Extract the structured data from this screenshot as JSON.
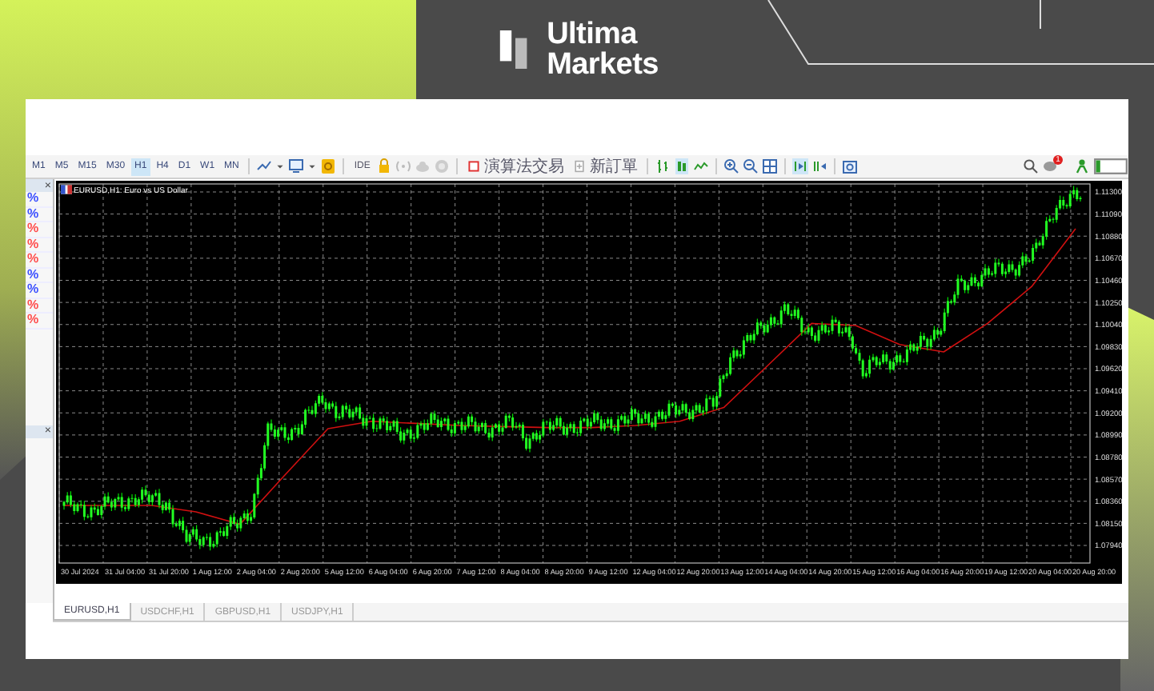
{
  "brand": {
    "line_1": "Ultima",
    "line_2": "Markets"
  },
  "toolbar": {
    "timeframes": [
      {
        "label": "M1",
        "selected": false
      },
      {
        "label": "M5",
        "selected": false
      },
      {
        "label": "M15",
        "selected": false
      },
      {
        "label": "M30",
        "selected": false
      },
      {
        "label": "H1",
        "selected": true
      },
      {
        "label": "H4",
        "selected": false
      },
      {
        "label": "D1",
        "selected": false
      },
      {
        "label": "W1",
        "selected": false
      },
      {
        "label": "MN",
        "selected": false
      }
    ],
    "ide_label": "IDE",
    "algo_trading_label": "演算法交易",
    "new_order_label": "新訂單",
    "notification_count": "1"
  },
  "market_watch": {
    "close_symbol": "×",
    "rows": [
      {
        "change": "%",
        "color": "#3c50ff"
      },
      {
        "change": "%",
        "color": "#3c50ff"
      },
      {
        "change": "%",
        "color": "#ff4d4d"
      },
      {
        "change": "%",
        "color": "#ff4d4d"
      },
      {
        "change": "%",
        "color": "#ff4d4d"
      },
      {
        "change": "%",
        "color": "#3c50ff"
      },
      {
        "change": "%",
        "color": "#3c50ff"
      },
      {
        "change": "%",
        "color": "#ff4d4d"
      },
      {
        "change": "%",
        "color": "#ff4d4d"
      }
    ]
  },
  "navigator": {
    "close_symbol": "×"
  },
  "chart": {
    "title": "EURUSD,H1: Euro vs US Dollar",
    "chart_data": {
      "type": "line",
      "grid": true,
      "categories": [
        "30 Jul 2024",
        "31 Jul 04:00",
        "31 Jul 20:00",
        "1 Aug 12:00",
        "2 Aug 04:00",
        "2 Aug 20:00",
        "5 Aug 12:00",
        "6 Aug 04:00",
        "6 Aug 20:00",
        "7 Aug 12:00",
        "8 Aug 04:00",
        "8 Aug 20:00",
        "9 Aug 12:00",
        "12 Aug 04:00",
        "12 Aug 20:00",
        "13 Aug 12:00",
        "14 Aug 04:00",
        "14 Aug 20:00",
        "15 Aug 12:00",
        "16 Aug 04:00",
        "16 Aug 20:00",
        "19 Aug 12:00",
        "20 Aug 04:00",
        "20 Aug 20:00"
      ],
      "ylim": [
        1.0794,
        1.113
      ],
      "yticks": [
        {
          "value": 1.113,
          "label": "1.11300"
        },
        {
          "value": 1.1109,
          "label": "1.11090"
        },
        {
          "value": 1.1088,
          "label": "1.10880"
        },
        {
          "value": 1.1067,
          "label": "1.10670"
        },
        {
          "value": 1.1046,
          "label": "1.10460"
        },
        {
          "value": 1.1025,
          "label": "1.10250"
        },
        {
          "value": 1.1004,
          "label": "1.10040"
        },
        {
          "value": 1.0983,
          "label": "1.09830"
        },
        {
          "value": 1.0962,
          "label": "1.09620"
        },
        {
          "value": 1.0941,
          "label": "1.09410"
        },
        {
          "value": 1.092,
          "label": "1.09200"
        },
        {
          "value": 1.0899,
          "label": "1.08990"
        },
        {
          "value": 1.0878,
          "label": "1.08780"
        },
        {
          "value": 1.0857,
          "label": "1.08570"
        },
        {
          "value": 1.0836,
          "label": "1.08360"
        },
        {
          "value": 1.0815,
          "label": "1.08150"
        },
        {
          "value": 1.0794,
          "label": "1.07940"
        }
      ],
      "series": [
        {
          "color": "#d01010",
          "values": [
            1.0832,
            1.0832,
            1.0832,
            1.0826,
            1.0814,
            1.086,
            1.0905,
            1.0912,
            1.091,
            1.0908,
            1.0907,
            1.0906,
            1.0906,
            1.0908,
            1.0912,
            1.0925,
            1.0965,
            1.1005,
            1.1003,
            1.0985,
            1.0978,
            1.1005,
            1.104,
            1.1095
          ]
        }
      ]
    }
  },
  "chart_tabs": [
    {
      "label": "EURUSD,H1",
      "selected": true
    },
    {
      "label": "USDCHF,H1",
      "selected": false
    },
    {
      "label": "GBPUSD,H1",
      "selected": false
    },
    {
      "label": "USDJPY,H1",
      "selected": false
    }
  ]
}
